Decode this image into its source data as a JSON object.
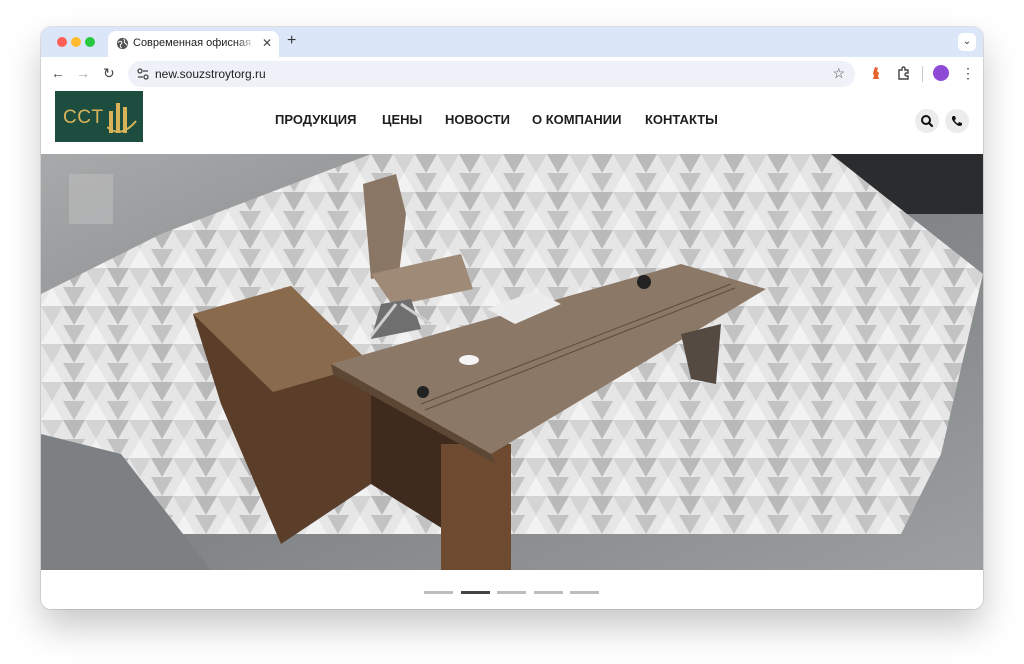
{
  "browser": {
    "tab_title": "Современная офисная мебе",
    "url": "new.souzstroytorg.ru",
    "controls": {
      "close_tab": "✕",
      "new_tab": "+",
      "tab_menu": "⌄",
      "back": "←",
      "forward": "→",
      "reload": "↻",
      "bookmark": "☆",
      "menu": "⋮"
    }
  },
  "site": {
    "logo_text": "CCT",
    "nav": [
      "ПРОДУКЦИЯ",
      "ЦЕНЫ",
      "НОВОСТИ",
      "О КОМПАНИИ",
      "КОНТАКТЫ"
    ],
    "header_icons": [
      "search-icon",
      "phone-icon"
    ],
    "colors": {
      "logo_bg": "#1d4d3e",
      "logo_gold": "#d8b35a",
      "nav_text": "#1e1e1e"
    }
  },
  "hero": {
    "image_desc_icon": "office-desk-photo",
    "slides_total": 5,
    "active_slide": 2
  }
}
